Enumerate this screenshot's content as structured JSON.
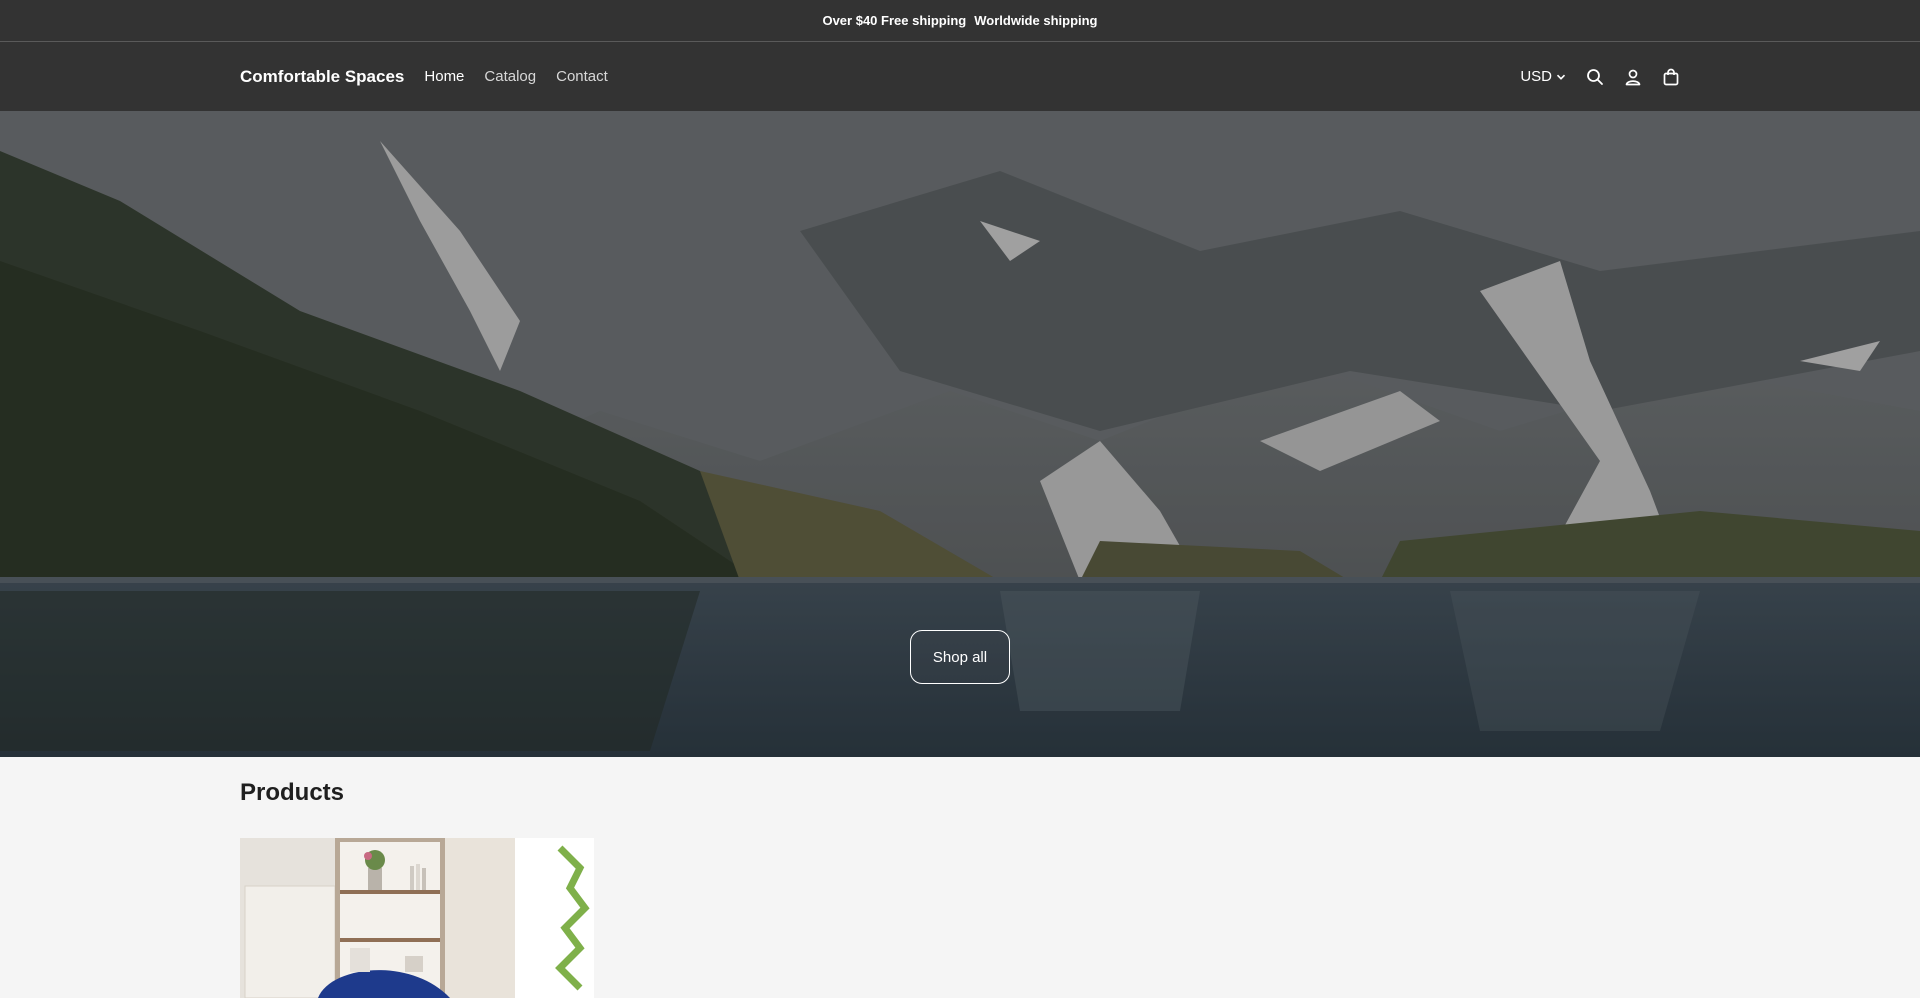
{
  "announcement": {
    "free_shipping": "Over $40 Free shipping",
    "worldwide": "Worldwide shipping"
  },
  "header": {
    "logo": "Comfortable Spaces",
    "nav": [
      {
        "label": "Home",
        "active": true
      },
      {
        "label": "Catalog",
        "active": false
      },
      {
        "label": "Contact",
        "active": false
      }
    ],
    "currency": "USD",
    "icons": [
      "search-icon",
      "account-icon",
      "cart-icon"
    ]
  },
  "hero": {
    "button_label": "Shop all",
    "image": "mountain-lake-photo"
  },
  "products": {
    "heading": "Products",
    "items": [
      {
        "image": "living-room-armchair-photo"
      }
    ]
  },
  "colors": {
    "header_bg": "#333333",
    "page_bg": "#f5f5f5",
    "text": "#222222"
  }
}
